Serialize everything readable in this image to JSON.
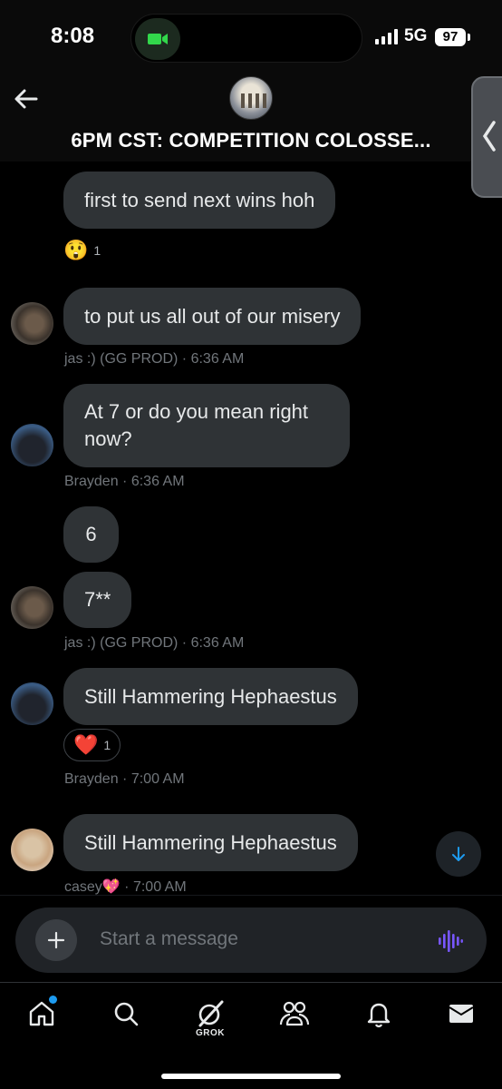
{
  "status_bar": {
    "time": "8:08",
    "network": "5G",
    "battery": "97"
  },
  "header": {
    "title": "6PM CST: COMPETITION COLOSSE...",
    "back_icon": "arrow-left-icon"
  },
  "messages": [
    {
      "text": "first to send next wins hoh",
      "reaction": {
        "emoji": "😲",
        "count": "1"
      }
    },
    {
      "text": "to put us all out of our misery",
      "sender": "jas :) (GG PROD)",
      "time": "· 6:36 AM"
    },
    {
      "text_line1": "At 7 or do you mean right",
      "text_line2": "now?",
      "sender": "Brayden",
      "time": "· 6:36 AM"
    },
    {
      "text": "6"
    },
    {
      "text": "7**",
      "sender": "jas :) (GG PROD)",
      "time": "· 6:36 AM"
    },
    {
      "text": "Still Hammering Hephaestus",
      "reaction": {
        "emoji": "❤️",
        "count": "1"
      },
      "sender": "Brayden",
      "time": "· 7:00 AM"
    },
    {
      "text": "Still Hammering Hephaestus",
      "sender": "casey💖",
      "time": "· 7:00 AM"
    }
  ],
  "composer": {
    "placeholder": "Start a message"
  },
  "tabs": {
    "grok_label": "GROK"
  },
  "colors": {
    "accent": "#1d9bf0",
    "bubble": "#2f3336",
    "voice": "#7856ff"
  }
}
